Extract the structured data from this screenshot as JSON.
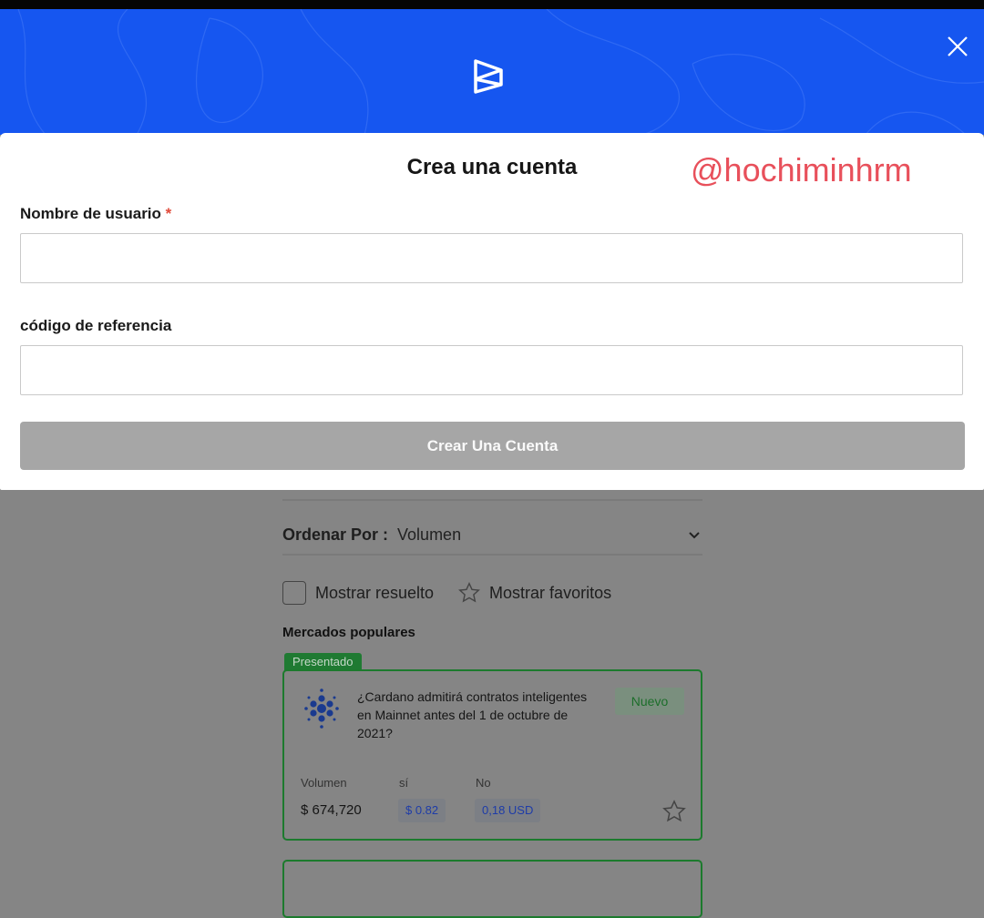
{
  "modal": {
    "title": "Crea una cuenta",
    "watermark": "@hochiminhrm",
    "username_label": "Nombre de usuario",
    "required_mark": "*",
    "username_value": "",
    "referral_label": "código de referencia",
    "referral_value": "",
    "submit_label": "Crear Una Cuenta",
    "icons": {
      "logo": "brand-logo-icon",
      "close": "close-icon"
    },
    "colors": {
      "header": "#1656f0",
      "submit_disabled": "#a6a6a6",
      "watermark": "#e8505b"
    }
  },
  "background": {
    "sort": {
      "label": "Ordenar Por :",
      "value": "Volumen"
    },
    "show_resolved": "Mostrar resuelto",
    "show_favorites": "Mostrar favoritos",
    "section_title": "Mercados populares",
    "featured_tag": "Presentado",
    "market": {
      "question": "¿Cardano admitirá contratos inteligentes en Mainnet antes del 1 de octubre de 2021?",
      "badge": "Nuevo",
      "volume_label": "Volumen",
      "yes_label": "sí",
      "no_label": "No",
      "volume": "$ 674,720",
      "yes_price": "$ 0.82",
      "no_price": "0,18 USD"
    }
  }
}
